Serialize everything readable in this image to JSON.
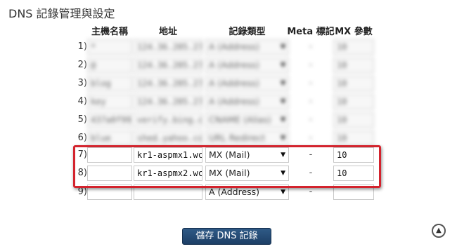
{
  "page_title": "DNS 記錄管理與設定",
  "headers": {
    "host": "主機名稱",
    "address": "地址",
    "type": "記錄類型",
    "meta": "Meta 標記",
    "mx": "MX 參數"
  },
  "rows": [
    {
      "num": "1)",
      "host": "*",
      "address": "124.36.205.27",
      "type": "A (Address)",
      "meta": "-",
      "mx": "10"
    },
    {
      "num": "2)",
      "host": "@",
      "address": "124.36.205.27",
      "type": "A (Address)",
      "meta": "-",
      "mx": "10"
    },
    {
      "num": "3)",
      "host": "blog",
      "address": "124.36.205.27",
      "type": "A (Address)",
      "meta": "-",
      "mx": "10"
    },
    {
      "num": "4)",
      "host": "key",
      "address": "124.36.205.27",
      "type": "A (Address)",
      "meta": "-",
      "mx": "10"
    },
    {
      "num": "5)",
      "host": "437a0f99",
      "address": "verify.bing.c",
      "type": "CNAME (Alias)",
      "meta": "-",
      "mx": "10"
    },
    {
      "num": "6)",
      "host": "blue",
      "address": "shed.yahoo.co",
      "type": "URL Redirect",
      "meta": "-",
      "mx": "10"
    },
    {
      "num": "7)",
      "host": "",
      "address": "kr1-aspmx1.wc",
      "type": "MX (Mail)",
      "meta": "-",
      "mx": "10"
    },
    {
      "num": "8)",
      "host": "",
      "address": "kr1-aspmx2.wc",
      "type": "MX (Mail)",
      "meta": "-",
      "mx": "10"
    },
    {
      "num": "9)",
      "host": "",
      "address": "",
      "type": "A (Address)",
      "meta": "-",
      "mx": ""
    }
  ],
  "save_button": "儲存 DNS 記錄",
  "colors": {
    "highlight": "#d3232d",
    "button": "#1d3f66"
  },
  "icons": {
    "select_arrow": "dropdown-arrow-icon",
    "scroll_top": "scroll-top-icon"
  }
}
